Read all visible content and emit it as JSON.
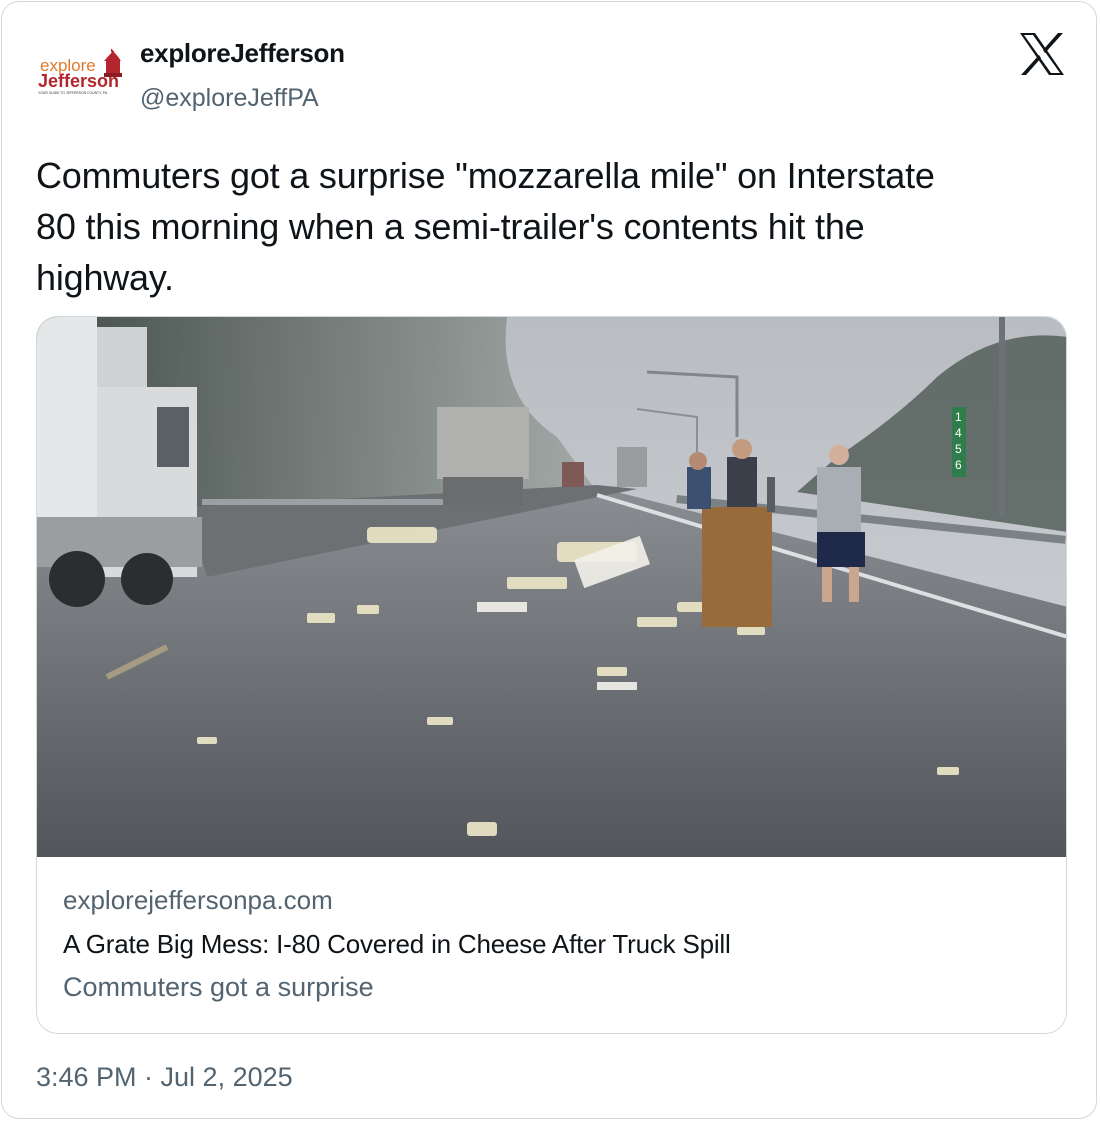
{
  "author": {
    "display_name": "exploreJefferson",
    "handle": "@exploreJeffPA",
    "avatar_logo": {
      "line1": "explore",
      "line2": "Jefferson",
      "tagline": "YOUR GUIDE TO JEFFERSON COUNTY, PA"
    }
  },
  "brand_icon": "x-logo-icon",
  "tweet": {
    "text": "Commuters got a surprise \"mozzarella mile\" on Interstate\n80 this morning when a semi-trailer's contents hit the\nhighway.",
    "timestamp": "3:46 PM · Jul 2, 2025"
  },
  "link_card": {
    "domain": "explorejeffersonpa.com",
    "title": "A Grate Big Mess: I-80 Covered in Cheese After Truck Spill",
    "description": "Commuters got a surprise",
    "image_sign": [
      "1",
      "4",
      "5",
      "6"
    ]
  },
  "colors": {
    "text_primary": "#0f1419",
    "text_secondary": "#536471",
    "border": "#cfd9de",
    "logo_orange": "#e07a2a",
    "logo_red": "#b3262d"
  }
}
